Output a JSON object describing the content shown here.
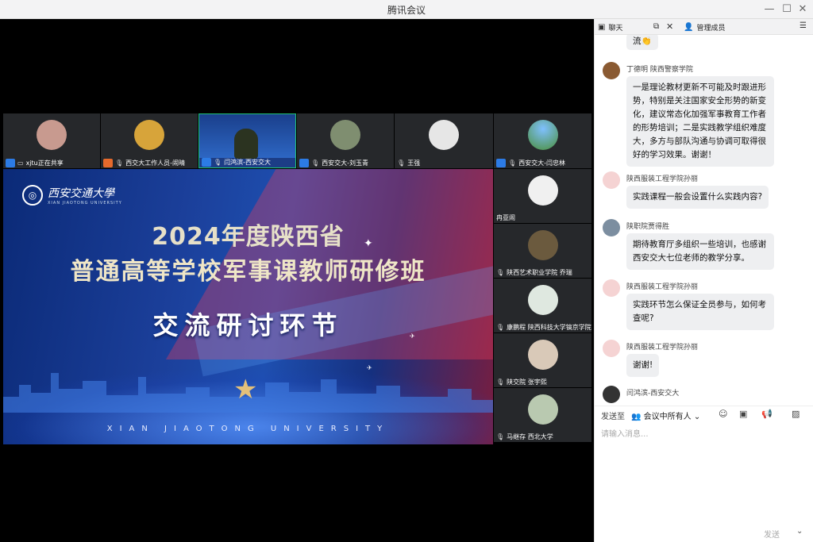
{
  "window": {
    "title": "腾讯会议"
  },
  "participants_top": [
    {
      "name": "xjtu正在共享",
      "avatar_color": "#c89a8f",
      "badge_color": "#2c7be5",
      "sharing": true
    },
    {
      "name": "西交大工作人员-闹晴",
      "avatar_color": "#d7a43a",
      "badge_color": "#e66a2c"
    },
    {
      "name": "闫鸿滨-西安交大",
      "avatar_color": "#2a56a8",
      "badge_color": "#2c7be5",
      "active": true
    },
    {
      "name": "西安交大-刘玉青",
      "avatar_color": "#7f8e70",
      "badge_color": "#2c7be5"
    },
    {
      "name": "王强",
      "avatar_color": "#e6e6e6"
    },
    {
      "name": "西安交大-闫忠林",
      "avatar_color": "#5aa0e0",
      "badge_color": "#2c7be5"
    }
  ],
  "participants_side": [
    {
      "name": "冉亚闹",
      "avatar_color": "#f0f0f0"
    },
    {
      "name": "陕西艺术职业学院 乔瑞",
      "avatar_color": "#6b5a3e"
    },
    {
      "name": "康鹏程 陕西科技大学镐京学院",
      "avatar_color": "#dfe8e0"
    },
    {
      "name": "陕交院 张宇熙",
      "avatar_color": "#d9c9b8"
    },
    {
      "name": "马继存 西北大学",
      "avatar_color": "#b9c9b0"
    }
  ],
  "share": {
    "university_cn": "西安交通大學",
    "university_en": "XIAN JIAOTONG UNIVERSITY",
    "title_line1": "2024年度陕西省",
    "title_line2": "普通高等学校军事课教师研修班",
    "title_line3": "交流研讨环节",
    "footer": "XIAN JIAOTONG UNIVERSITY"
  },
  "chat": {
    "tabs": {
      "chat": "聊天",
      "members": "管理成员"
    },
    "messages": [
      {
        "sender": "",
        "text": "流👏",
        "avatar_color": ""
      },
      {
        "sender": "丁德明  陕西警察学院",
        "avatar_color": "#8a5a32",
        "lines": [
          "一是理论教材更新不可能及时跟进形",
          "势，特别是关注国家安全形势的新变",
          "化，建议常态化加强军事教育工作者",
          "的形势培训；二是实践教学组织难度",
          "大，多方与部队沟通与协调可取得很",
          "好的学习效果。谢谢！"
        ]
      },
      {
        "sender": "陕西服装工程学院孙丽",
        "avatar_color": "#f5d3d3",
        "lines": [
          "实践课程一般会设置什么实践内容?"
        ]
      },
      {
        "sender": "陕职院贾得胜",
        "avatar_color": "#7c8ea0",
        "lines": [
          "期待教育厅多组织一些培训，也感谢",
          "西安交大七位老师的教学分享。"
        ]
      },
      {
        "sender": "陕西服装工程学院孙丽",
        "avatar_color": "#f5d3d3",
        "lines": [
          "实践环节怎么保证全员参与，如何考",
          "查呢?"
        ]
      },
      {
        "sender": "陕西服装工程学院孙丽",
        "avatar_color": "#f5d3d3",
        "lines": [
          "谢谢!"
        ]
      },
      {
        "sender": "闫鸿滨-西安交大",
        "avatar_color": "#333333",
        "lines": []
      }
    ],
    "send_to_label": "发送至",
    "send_to_target": "会议中所有人",
    "input_placeholder": "请输入消息...",
    "send_label": "发送"
  },
  "icons": {
    "minimize": "minimize-icon",
    "maximize": "maximize-icon",
    "close": "close-icon"
  }
}
